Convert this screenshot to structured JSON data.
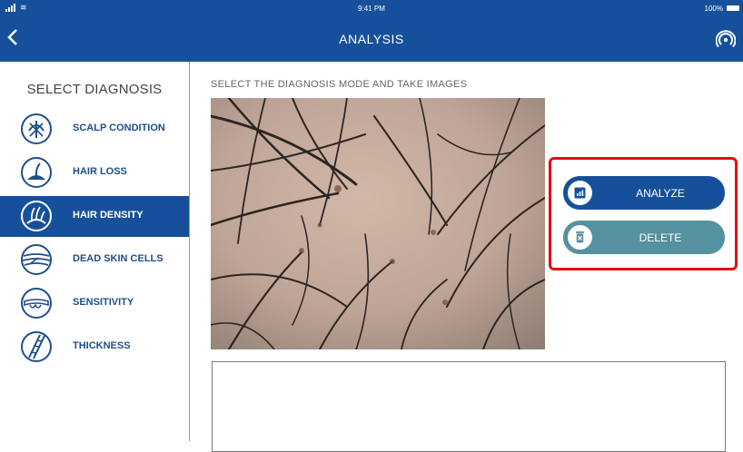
{
  "status_bar": {
    "time": "9:41 PM",
    "battery": "100%"
  },
  "nav": {
    "title": "ANALYSIS"
  },
  "sidebar": {
    "heading": "SELECT DIAGNOSIS",
    "items": [
      {
        "label": "SCALP CONDITION",
        "icon": "scalp-condition-icon",
        "active": false
      },
      {
        "label": "HAIR LOSS",
        "icon": "hair-loss-icon",
        "active": false
      },
      {
        "label": "HAIR DENSITY",
        "icon": "hair-density-icon",
        "active": true
      },
      {
        "label": "DEAD SKIN CELLS",
        "icon": "dead-skin-cells-icon",
        "active": false
      },
      {
        "label": "SENSITIVITY",
        "icon": "sensitivity-icon",
        "active": false
      },
      {
        "label": "THICKNESS",
        "icon": "thickness-icon",
        "active": false
      }
    ]
  },
  "main": {
    "heading": "SELECT THE DIAGNOSIS MODE AND TAKE IMAGES",
    "analyze_label": "ANALYZE",
    "delete_label": "DELETE"
  },
  "colors": {
    "primary": "#17509a",
    "delete": "#55919e",
    "highlight": "#e01010"
  }
}
